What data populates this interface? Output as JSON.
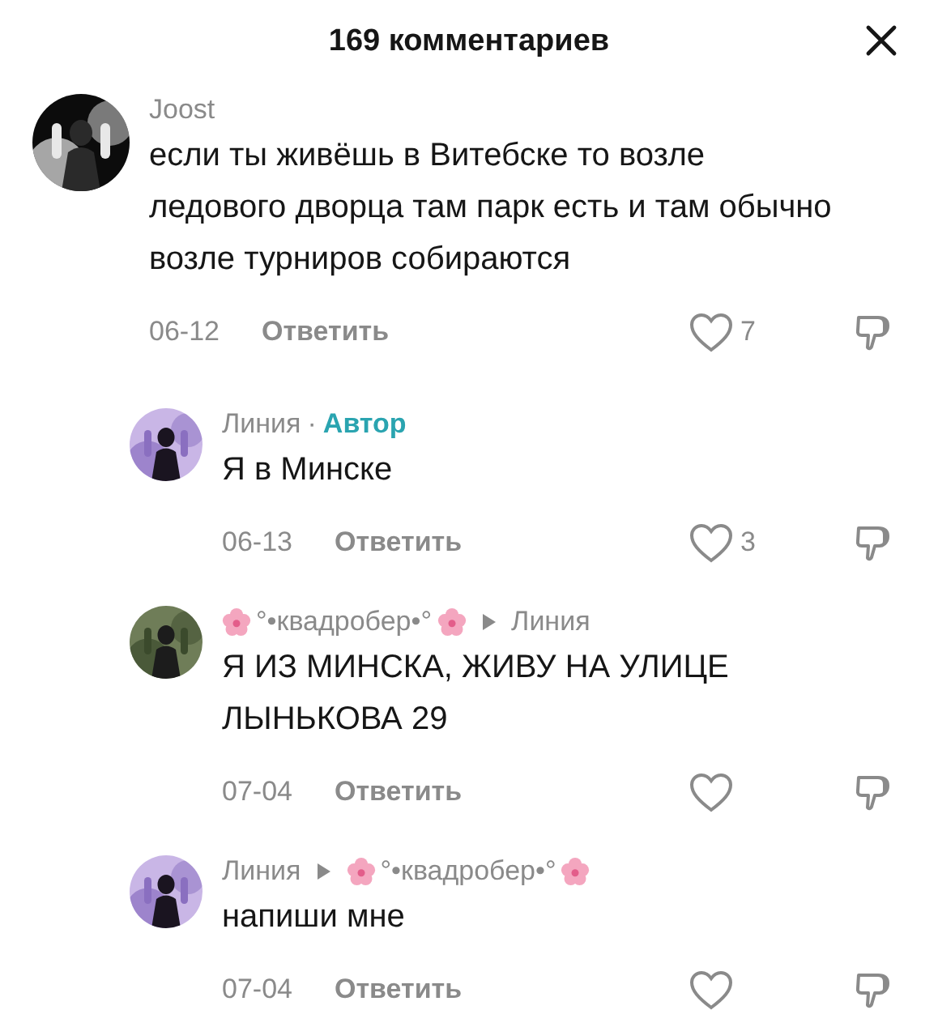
{
  "header": {
    "title": "169 комментариев"
  },
  "comments": [
    {
      "kind": "comment",
      "author": {
        "name": "Joost",
        "flowers": false
      },
      "text": "если ты живёшь в Витебске то возле ледового дворца там парк есть и там обычно возле турниров собираются",
      "date": "06-12",
      "reply_label": "Ответить",
      "liked": false,
      "likes": "7"
    },
    {
      "kind": "reply",
      "author": {
        "name": "Линия",
        "flowers": false
      },
      "separator": "·",
      "badge": "Автор",
      "text": "Я в Минске",
      "date": "06-13",
      "reply_label": "Ответить",
      "liked": false,
      "likes": "3"
    },
    {
      "kind": "reply",
      "author": {
        "name": "°•квадробер•°",
        "flowers": true
      },
      "reply_to": {
        "name": "Линия",
        "flowers": false
      },
      "text": "Я ИЗ МИНСКА, ЖИВУ НА УЛИЦЕ ЛЫНЬКОВА 29",
      "date": "07-04",
      "reply_label": "Ответить",
      "liked": false
    },
    {
      "kind": "reply",
      "author": {
        "name": "Линия",
        "flowers": false
      },
      "reply_to": {
        "name": "°•квадробер•°",
        "flowers": true
      },
      "text": "напиши мне",
      "date": "07-04",
      "reply_label": "Ответить",
      "liked": false
    }
  ]
}
